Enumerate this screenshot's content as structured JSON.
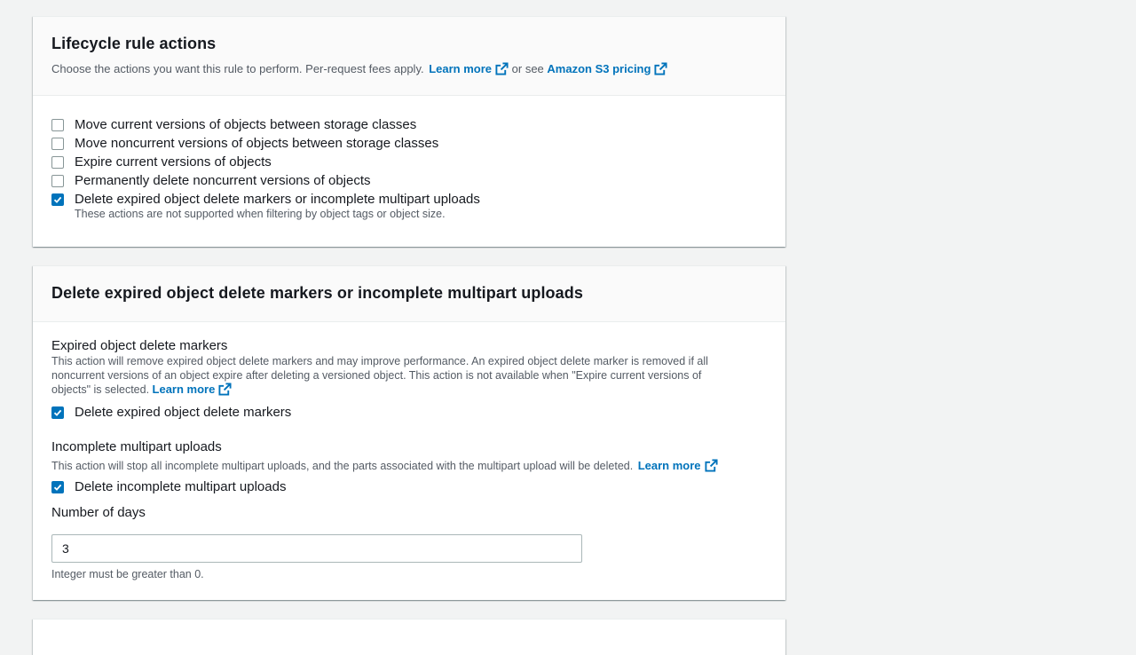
{
  "lifecycle": {
    "title": "Lifecycle rule actions",
    "description": "Choose the actions you want this rule to perform. Per-request fees apply.",
    "learn_more": "Learn more",
    "or_see": "or see",
    "pricing_link": "Amazon S3 pricing",
    "options": [
      {
        "label": "Move current versions of objects between storage classes",
        "checked": false
      },
      {
        "label": "Move noncurrent versions of objects between storage classes",
        "checked": false
      },
      {
        "label": "Expire current versions of objects",
        "checked": false
      },
      {
        "label": "Permanently delete noncurrent versions of objects",
        "checked": false
      },
      {
        "label": "Delete expired object delete markers or incomplete multipart uploads",
        "checked": true
      }
    ],
    "note": "These actions are not supported when filtering by object tags or object size."
  },
  "delete_section": {
    "title": "Delete expired object delete markers or incomplete multipart uploads",
    "markers": {
      "heading": "Expired object delete markers",
      "desc_line1": "This action will remove expired object delete markers and may improve performance. An expired object delete marker is removed if all",
      "desc_line2": "noncurrent versions of an object expire after deleting a versioned object. This action is not available when \"Expire current versions of",
      "desc_line3": "objects\" is selected.",
      "learn_more": "Learn more",
      "checkbox_label": "Delete expired object delete markers",
      "checked": true
    },
    "multipart": {
      "heading": "Incomplete multipart uploads",
      "desc": "This action will stop all incomplete multipart uploads, and the parts associated with the multipart upload will be deleted.",
      "learn_more": "Learn more",
      "checkbox_label": "Delete incomplete multipart uploads",
      "checked": true
    },
    "days": {
      "label": "Number of days",
      "value": "3",
      "hint": "Integer must be greater than 0."
    }
  },
  "colors": {
    "link": "#0073bb",
    "checkbox_checked": "#0073bb",
    "page_bg": "#f2f3f3"
  }
}
